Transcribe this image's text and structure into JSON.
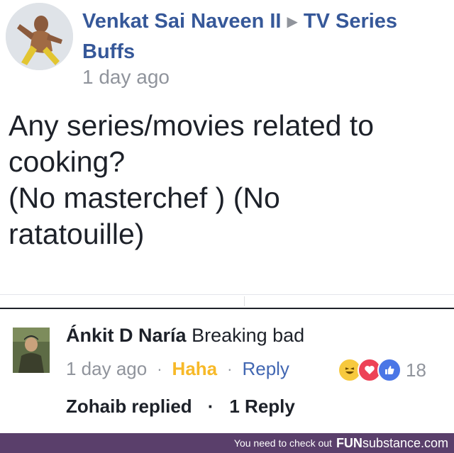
{
  "post": {
    "author": "Venkat Sai Naveen II",
    "group": "TV Series Buffs",
    "timestamp": "1 day ago",
    "text": "Any series/movies related to\ncooking?\n(No masterchef ) (No\nratatouille)"
  },
  "comment": {
    "author": "Ánkit D Naría",
    "text": "Breaking bad",
    "timestamp": "1 day ago",
    "reaction_label": "Haha",
    "reply_label": "Reply",
    "reaction_icons": [
      "haha-icon",
      "love-icon",
      "like-icon"
    ],
    "reaction_count": "18",
    "replied_by": "Zohaib replied",
    "reply_count": "1 Reply"
  },
  "footer": {
    "text": "You need to check out",
    "brand_strong": "FUN",
    "brand_rest": "substance.com"
  },
  "colors": {
    "link": "#365899",
    "meta": "#90949c",
    "haha": "#f7b928",
    "reply": "#4267b2",
    "footer_bg": "#5a3f6b"
  }
}
